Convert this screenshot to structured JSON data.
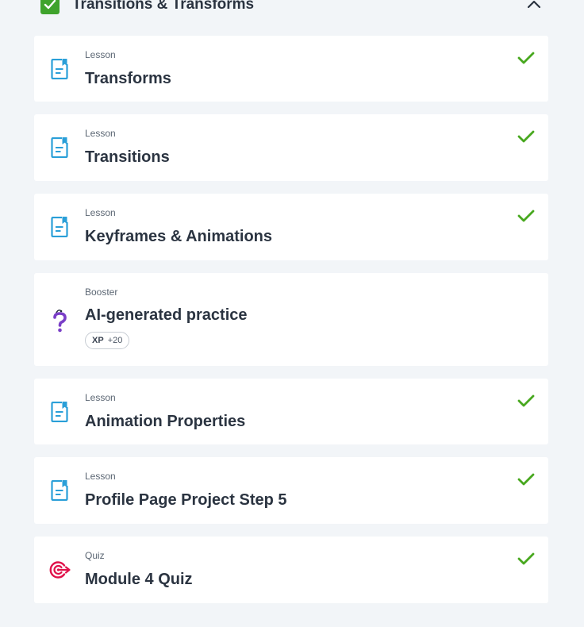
{
  "module": {
    "title": "Transitions & Transforms",
    "completed": true,
    "expanded": true,
    "collapse_icon": "chevron-up-icon"
  },
  "colors": {
    "lesson_icon": "#2a9fd8",
    "booster_icon": "#7a3fc7",
    "quiz_icon": "#e0114a",
    "check": "#48a81f"
  },
  "items": [
    {
      "type": "Lesson",
      "title": "Transforms",
      "icon": "lesson-document-icon",
      "completed": true
    },
    {
      "type": "Lesson",
      "title": "Transitions",
      "icon": "lesson-document-icon",
      "completed": true
    },
    {
      "type": "Lesson",
      "title": "Keyframes & Animations",
      "icon": "lesson-document-icon",
      "completed": true
    },
    {
      "type": "Booster",
      "title": "AI-generated practice",
      "icon": "question-mark-icon",
      "completed": false,
      "xp_label": "XP",
      "xp_value": "+20"
    },
    {
      "type": "Lesson",
      "title": "Animation Properties",
      "icon": "lesson-document-icon",
      "completed": true
    },
    {
      "type": "Lesson",
      "title": "Profile Page Project Step 5",
      "icon": "lesson-document-icon",
      "completed": true
    },
    {
      "type": "Quiz",
      "title": "Module 4 Quiz",
      "icon": "target-icon",
      "completed": true
    }
  ]
}
